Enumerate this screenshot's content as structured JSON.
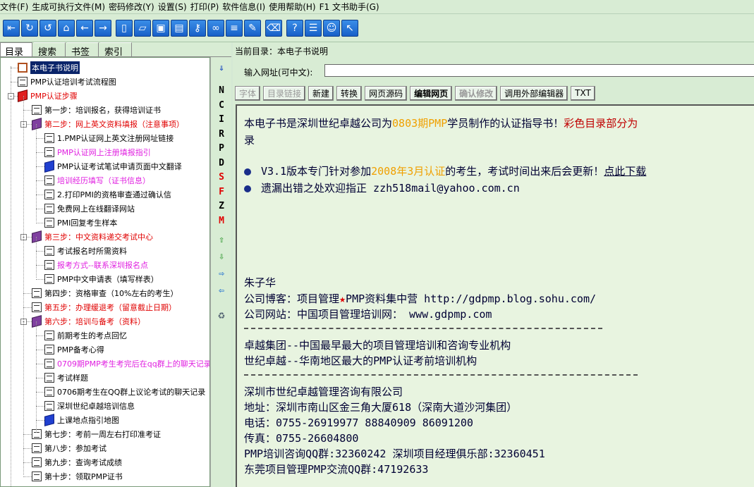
{
  "menu": [
    "文件(F)",
    "生成可执行文件(M)",
    "密码修改(Y)",
    "设置(S)",
    "打印(P)",
    "软件信息(I)",
    "使用帮助(H)",
    "F1 文书助手(G)"
  ],
  "toolbar_icons": [
    "exit-icon",
    "refresh-icon",
    "undo-icon",
    "home-icon",
    "back-icon",
    "forward-icon",
    "new-page-icon",
    "open-icon",
    "save-icon",
    "save-as-icon",
    "key-icon",
    "link-icon",
    "notes-icon",
    "edit-icon",
    "eraser-icon",
    "help-icon",
    "list-icon",
    "smiley-icon",
    "cursor-icon"
  ],
  "left_tabs": [
    "目录",
    "搜索",
    "书签",
    "索引"
  ],
  "tree": [
    {
      "label": "本电子书说明",
      "level": 1,
      "icon": "obook",
      "style": "sel"
    },
    {
      "label": "PMP认证培训考试流程图",
      "level": 1,
      "icon": "doc",
      "style": ""
    },
    {
      "label": "PMP认证步骤",
      "level": 1,
      "icon": "rbook",
      "style": "red",
      "exp": "-"
    },
    {
      "label": "第一步：培训报名，获得培训证书",
      "level": 2,
      "icon": "doc",
      "style": ""
    },
    {
      "label": "第二步：网上英文资料填报（注意事项）",
      "level": 2,
      "icon": "book",
      "style": "red",
      "exp": "-"
    },
    {
      "label": "1.PMP认证网上英文注册网址链接",
      "level": 3,
      "icon": "doc",
      "style": ""
    },
    {
      "label": "PMP认证网上注册填报指引",
      "level": 3,
      "icon": "doc",
      "style": "pink"
    },
    {
      "label": "PMP认证考试笔试申请页面中文翻译",
      "level": 3,
      "icon": "bbook",
      "style": ""
    },
    {
      "label": "培训经历填写（证书信息）",
      "level": 3,
      "icon": "doc",
      "style": "pink"
    },
    {
      "label": "2.打印PMI的资格审查通过确认信",
      "level": 3,
      "icon": "doc",
      "style": ""
    },
    {
      "label": "免费网上在线翻译网站",
      "level": 3,
      "icon": "doc",
      "style": ""
    },
    {
      "label": "PMI回复考生样本",
      "level": 3,
      "icon": "doc",
      "style": ""
    },
    {
      "label": "第三步：中文资料递交考试中心",
      "level": 2,
      "icon": "book",
      "style": "red",
      "exp": "-"
    },
    {
      "label": "考试报名时所需资料",
      "level": 3,
      "icon": "doc",
      "style": ""
    },
    {
      "label": "报考方式--联系深圳报名点",
      "level": 3,
      "icon": "doc",
      "style": "pink"
    },
    {
      "label": "PMP中文申请表（填写样表）",
      "level": 3,
      "icon": "doc",
      "style": ""
    },
    {
      "label": "第四步：资格审查（10%左右的考生）",
      "level": 2,
      "icon": "doc",
      "style": ""
    },
    {
      "label": "第五步：办理缓退考（留意截止日期）",
      "level": 2,
      "icon": "doc",
      "style": "red"
    },
    {
      "label": "第六步：培训与备考（资料）",
      "level": 2,
      "icon": "book",
      "style": "red",
      "exp": "-"
    },
    {
      "label": "前期考生的考点回忆",
      "level": 3,
      "icon": "doc",
      "style": ""
    },
    {
      "label": "PMP备考心得",
      "level": 3,
      "icon": "doc",
      "style": ""
    },
    {
      "label": "0709期PMP考生考完后在qq群上的聊天记录",
      "level": 3,
      "icon": "doc",
      "style": "pink"
    },
    {
      "label": "考试样题",
      "level": 3,
      "icon": "doc",
      "style": ""
    },
    {
      "label": "0706期考生在QQ群上议论考试的聊天记录",
      "level": 3,
      "icon": "doc",
      "style": ""
    },
    {
      "label": "深圳世纪卓越培训信息",
      "level": 3,
      "icon": "doc",
      "style": ""
    },
    {
      "label": "上课地点指引地图",
      "level": 3,
      "icon": "bbook",
      "style": ""
    },
    {
      "label": "第七步：考前一周左右打印准考证",
      "level": 2,
      "icon": "doc",
      "style": ""
    },
    {
      "label": "第八步：参加考试",
      "level": 2,
      "icon": "doc",
      "style": ""
    },
    {
      "label": "第九步：查询考试成绩",
      "level": 2,
      "icon": "doc",
      "style": ""
    },
    {
      "label": "第十步：领取PMP证书",
      "level": 2,
      "icon": "doc",
      "style": ""
    }
  ],
  "side_letters": [
    {
      "t": "N",
      "c": "#000"
    },
    {
      "t": "C",
      "c": "#000"
    },
    {
      "t": "I",
      "c": "#000"
    },
    {
      "t": "R",
      "c": "#000"
    },
    {
      "t": "P",
      "c": "#000"
    },
    {
      "t": "D",
      "c": "#000"
    },
    {
      "t": "S",
      "c": "#e00000"
    },
    {
      "t": "F",
      "c": "#e00000"
    },
    {
      "t": "Z",
      "c": "#000"
    },
    {
      "t": "M",
      "c": "#e00000"
    }
  ],
  "current_dir": "当前目录：本电子书说明",
  "url_label": "输入网址(可中文):",
  "url_value": "",
  "buttons": [
    {
      "label": "字体",
      "dis": true
    },
    {
      "label": "目录链接",
      "dis": true
    },
    {
      "label": "新建",
      "dis": false
    },
    {
      "label": "转换",
      "dis": false
    },
    {
      "label": "网页源码",
      "dis": false
    },
    {
      "label": "编辑网页",
      "dis": false,
      "bold": true
    },
    {
      "label": "确认修改",
      "dis": true,
      "bold": true
    },
    {
      "label": "调用外部编辑器",
      "dis": false
    },
    {
      "label": "TXT",
      "dis": false
    }
  ],
  "content": {
    "intro_a": "本电子书是深圳世纪卓越公司为",
    "intro_b": "0803期PMP",
    "intro_c": "学员制作的认证指导书！",
    "intro_d": "彩色目录部分为",
    "intro_e": "录",
    "bullet1_a": "V3.1版本专门针对参加",
    "bullet1_b": "2008年3月认证",
    "bullet1_c": "的考生，考试时间出来后会更新！",
    "bullet1_d": "点此下载",
    "bullet2": "遗漏出错之处欢迎指正 zzh518mail@yahoo.com.cn",
    "name": "朱子华",
    "blog_a": "公司博客：项目管理",
    "blog_star": "★",
    "blog_b": "PMP资料集中营  http://gdpmp.blog.sohu.com/",
    "site": "公司网站：中国项目管理培训网：  www.gdpmp.com",
    "line1": "卓越集团--中国最早最大的项目管理培训和咨询专业机构",
    "line2": "世纪卓越--华南地区最大的PMP认证考前培训机构",
    "company": "深圳市世纪卓越管理咨询有限公司",
    "addr": "地址：深圳市南山区金三角大厦618（深南大道沙河集团）",
    "tel": "电话：0755-26919977 88840909  86091200",
    "fax": "传真：0755-26604800",
    "qq1": "PMP培训咨询QQ群:32360242   深圳项目经理俱乐部:32360451",
    "qq2": "东莞项目管理PMP交流QQ群:47192633"
  }
}
